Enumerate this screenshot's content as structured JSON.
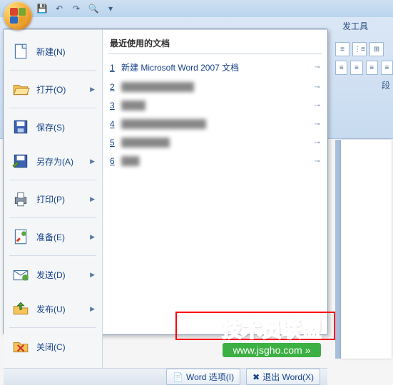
{
  "qat": {
    "save": "💾",
    "undo": "↶",
    "redo": "↷",
    "preview": "🔍"
  },
  "ribbon": {
    "dev_tab": "发工具",
    "paragraph_label": "段"
  },
  "menu": {
    "items": [
      {
        "label": "新建(N)",
        "icon": "new"
      },
      {
        "label": "打开(O)",
        "icon": "open",
        "arrow": true
      },
      {
        "label": "保存(S)",
        "icon": "save"
      },
      {
        "label": "另存为(A)",
        "icon": "saveas",
        "arrow": true
      },
      {
        "label": "打印(P)",
        "icon": "print",
        "arrow": true
      },
      {
        "label": "准备(E)",
        "icon": "prepare",
        "arrow": true
      },
      {
        "label": "发送(D)",
        "icon": "send",
        "arrow": true
      },
      {
        "label": "发布(U)",
        "icon": "publish",
        "arrow": true
      },
      {
        "label": "关闭(C)",
        "icon": "close"
      }
    ],
    "recent_title": "最近使用的文档",
    "recent": [
      {
        "n": "1",
        "label": "新建 Microsoft Word 2007 文档"
      },
      {
        "n": "2",
        "label": "████████████"
      },
      {
        "n": "3",
        "label": "████"
      },
      {
        "n": "4",
        "label": "██████████████"
      },
      {
        "n": "5",
        "label": "████████"
      },
      {
        "n": "6",
        "label": "███"
      }
    ],
    "footer": {
      "options": "Word 选项(I)",
      "exit": "退出 Word(X)"
    }
  },
  "watermark": {
    "title": "技术员联盟",
    "url": "www.jsgho.com",
    "arrow": "»"
  }
}
